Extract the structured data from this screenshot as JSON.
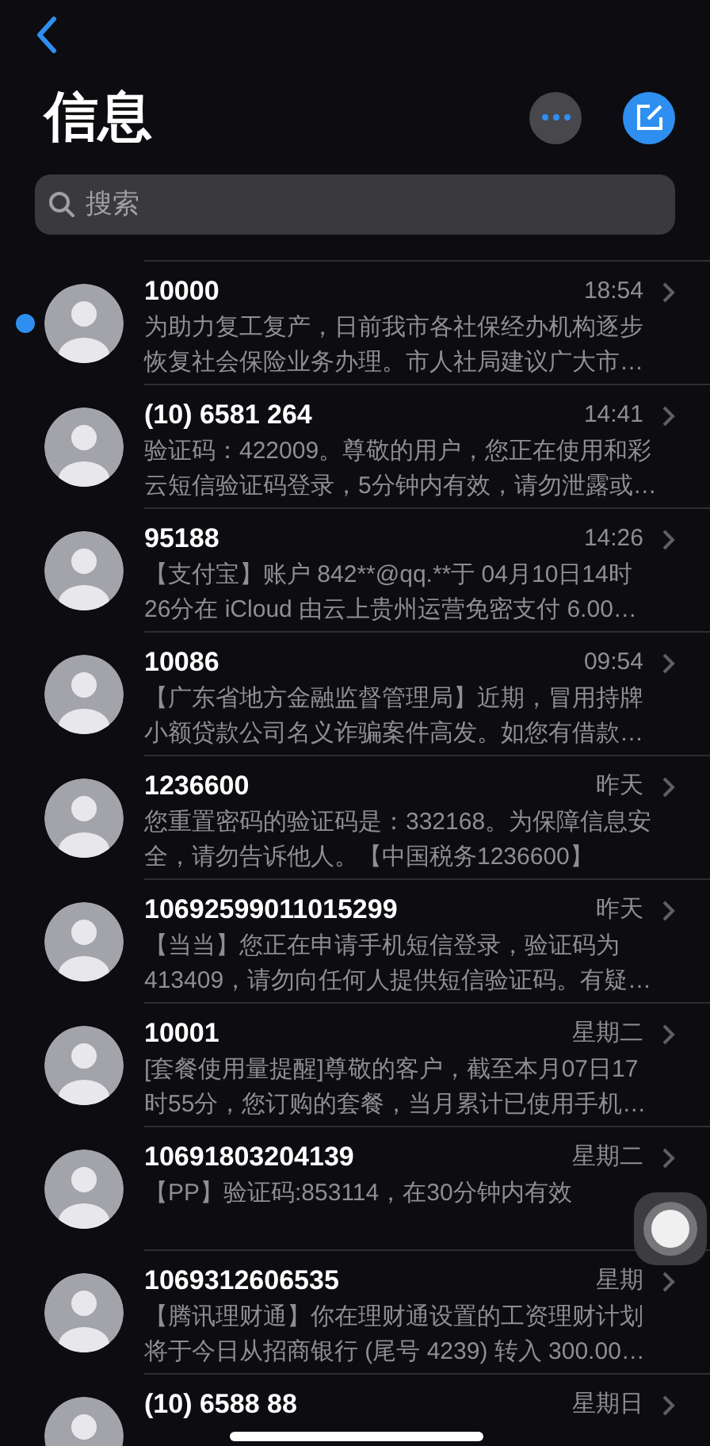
{
  "title": "信息",
  "search": {
    "placeholder": "搜索"
  },
  "conversations": [
    {
      "name": "10000",
      "time": "18:54",
      "unread": true,
      "preview_lines": [
        "为助力复工复产，日前我市各社保经办机构逐步",
        "恢复社会保险业务办理。市人社局建议广大市…"
      ]
    },
    {
      "name": "(10) 6581 264",
      "time": "14:41",
      "unread": false,
      "preview_lines": [
        "验证码：422009。尊敬的用户，您正在使用和彩",
        "云短信验证码登录，5分钟内有效，请勿泄露或…"
      ]
    },
    {
      "name": "95188",
      "time": "14:26",
      "unread": false,
      "preview_lines": [
        "【支付宝】账户 842**@qq.**于 04月10日14时",
        "26分在 iCloud 由云上贵州运营免密支付 6.00…"
      ]
    },
    {
      "name": "10086",
      "time": "09:54",
      "unread": false,
      "preview_lines": [
        "【广东省地方金融监督管理局】近期，冒用持牌",
        "小额贷款公司名义诈骗案件高发。如您有借款…"
      ]
    },
    {
      "name": "1236600",
      "time": "昨天",
      "unread": false,
      "preview_lines": [
        "您重置密码的验证码是：332168。为保障信息安",
        "全，请勿告诉他人。【中国税务1236600】"
      ]
    },
    {
      "name": "10692599011015299",
      "time": "昨天",
      "unread": false,
      "preview_lines": [
        "【当当】您正在申请手机短信登录，验证码为",
        "413409，请勿向任何人提供短信验证码。有疑…"
      ]
    },
    {
      "name": "10001",
      "time": "星期二",
      "unread": false,
      "preview_lines": [
        "[套餐使用量提醒]尊敬的客户，截至本月07日17",
        "时55分，您订购的套餐，当月累计已使用手机…"
      ]
    },
    {
      "name": "10691803204139",
      "time": "星期二",
      "unread": false,
      "preview_lines": [
        "【PP】验证码:853114，在30分钟内有效"
      ]
    },
    {
      "name": "1069312606535",
      "time": "星期",
      "unread": false,
      "preview_lines": [
        "【腾讯理财通】你在理财通设置的工资理财计划",
        "将于今日从招商银行 (尾号 4239) 转入 300.00…"
      ]
    },
    {
      "name": "(10) 6588 88",
      "time": "星期日",
      "unread": false
    }
  ]
}
